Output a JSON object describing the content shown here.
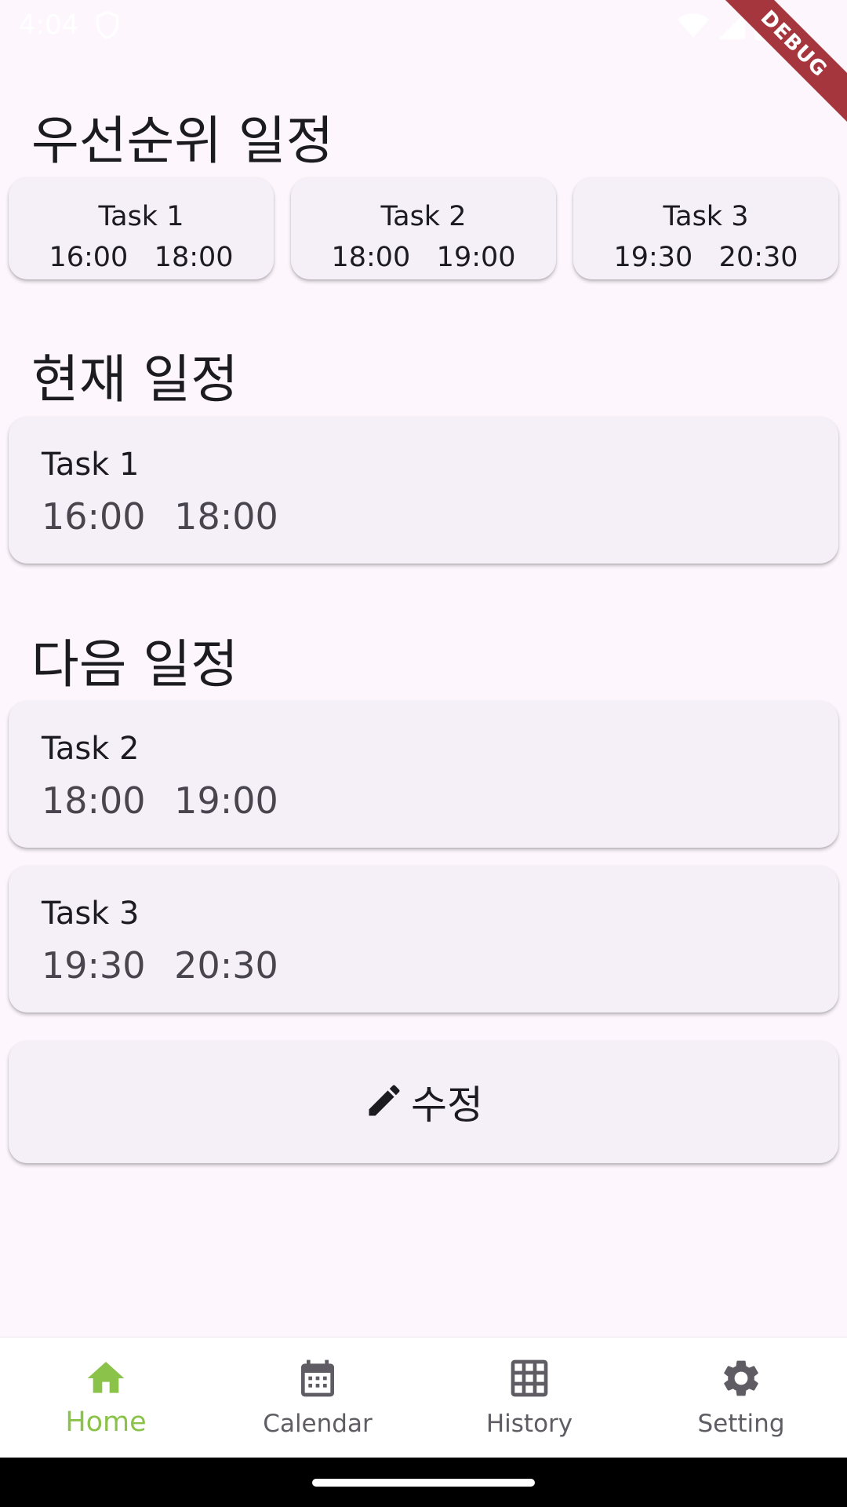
{
  "status_bar": {
    "time": "4:04"
  },
  "debug_banner": {
    "label": "DEBUG"
  },
  "sections": {
    "priority_title": "우선순위 일정",
    "current_title": "현재 일정",
    "next_title": "다음 일정"
  },
  "priority_tasks": [
    {
      "name": "Task 1",
      "time": "16:00   18:00"
    },
    {
      "name": "Task 2",
      "time": "18:00   19:00"
    },
    {
      "name": "Task 3",
      "time": "19:30   20:30"
    }
  ],
  "current_task": {
    "name": "Task 1",
    "time": "16:00 18:00"
  },
  "next_tasks": [
    {
      "name": "Task 2",
      "time": "18:00 19:00"
    },
    {
      "name": "Task 3",
      "time": "19:30 20:30"
    }
  ],
  "edit_button": {
    "label": "수정",
    "icon": "pencil-icon"
  },
  "bottom_nav": {
    "items": [
      {
        "label": "Home",
        "icon": "home-icon",
        "active": true
      },
      {
        "label": "Calendar",
        "icon": "calendar-icon",
        "active": false
      },
      {
        "label": "History",
        "icon": "grid-icon",
        "active": false
      },
      {
        "label": "Setting",
        "icon": "gear-icon",
        "active": false
      }
    ]
  },
  "colors": {
    "background": "#fdf7fd",
    "card": "#f5eff7",
    "accent": "#8bc34a",
    "nav_inactive": "#5f5d63",
    "debug_ribbon": "#a6363e"
  }
}
